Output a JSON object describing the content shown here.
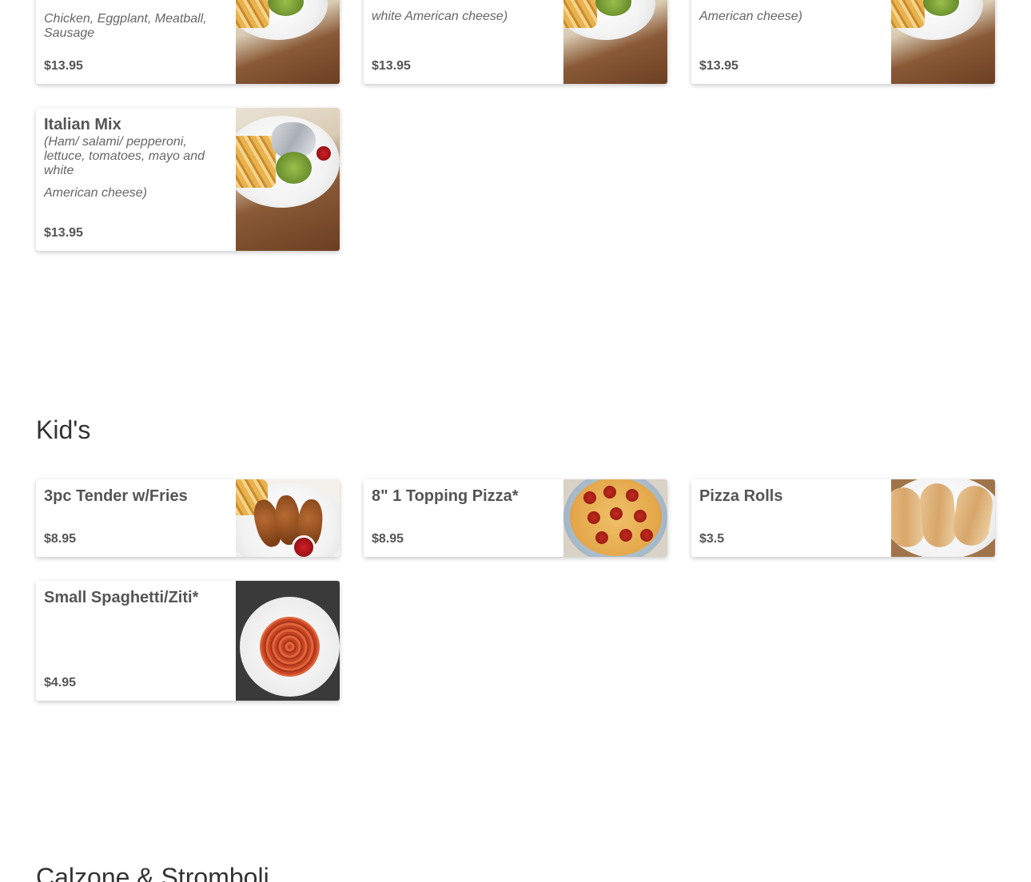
{
  "sections": {
    "kids_title": "Kid's",
    "calzone_title": "Calzone & Stromboli"
  },
  "top_row": [
    {
      "desc_visible": "Chicken, Eggplant, Meatball, Sausage",
      "price": "$13.95",
      "image": "wrap-with-fries-photo"
    },
    {
      "desc_visible": "white American cheese)",
      "price": "$13.95",
      "image": "wrap-with-fries-photo"
    },
    {
      "desc_visible": "American cheese)",
      "price": "$13.95",
      "image": "wrap-with-fries-photo"
    }
  ],
  "italian_mix": {
    "name": "Italian Mix",
    "desc": "(Ham/ salami/ pepperoni, lettuce, tomatoes, mayo and white",
    "desc2": "American cheese)",
    "price": "$13.95",
    "image": "wrap-with-fries-photo"
  },
  "kids": [
    {
      "name": "3pc Tender w/Fries",
      "price": "$8.95",
      "image": "chicken-tenders-photo"
    },
    {
      "name": "8\" 1 Topping Pizza*",
      "price": "$8.95",
      "image": "pepperoni-pizza-photo"
    },
    {
      "name": "Pizza Rolls",
      "price": "$3.5",
      "image": "pizza-rolls-photo"
    },
    {
      "name": "Small Spaghetti/Ziti*",
      "price": "$4.95",
      "image": "spaghetti-photo"
    }
  ]
}
